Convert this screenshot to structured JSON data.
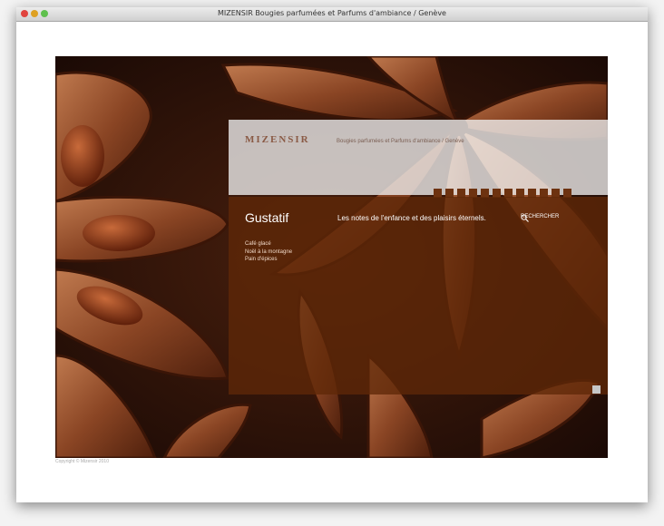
{
  "window": {
    "title": "MIZENSIR Bougies parfumées et Parfums d'ambiance / Genève",
    "controls": [
      "close",
      "minimize",
      "maximize"
    ]
  },
  "site": {
    "logo": "MIZENSIR",
    "tagline": "Bougies parfumées et Parfums d'ambiance / Genève",
    "section_title": "Gustatif",
    "headline": "Les notes de l'enfance et des plaisirs éternels.",
    "search_label": "RECHERCHER",
    "nav_items": [
      "Café glacé",
      "Noël à la montagne",
      "Pain d'épices"
    ],
    "tab_count": 12,
    "copyright": "Copyright © Mizensir 2010"
  },
  "colors": {
    "panel_brown": "#5f2808",
    "tab_brown": "#6d3210",
    "logo": "#8a5a45"
  }
}
